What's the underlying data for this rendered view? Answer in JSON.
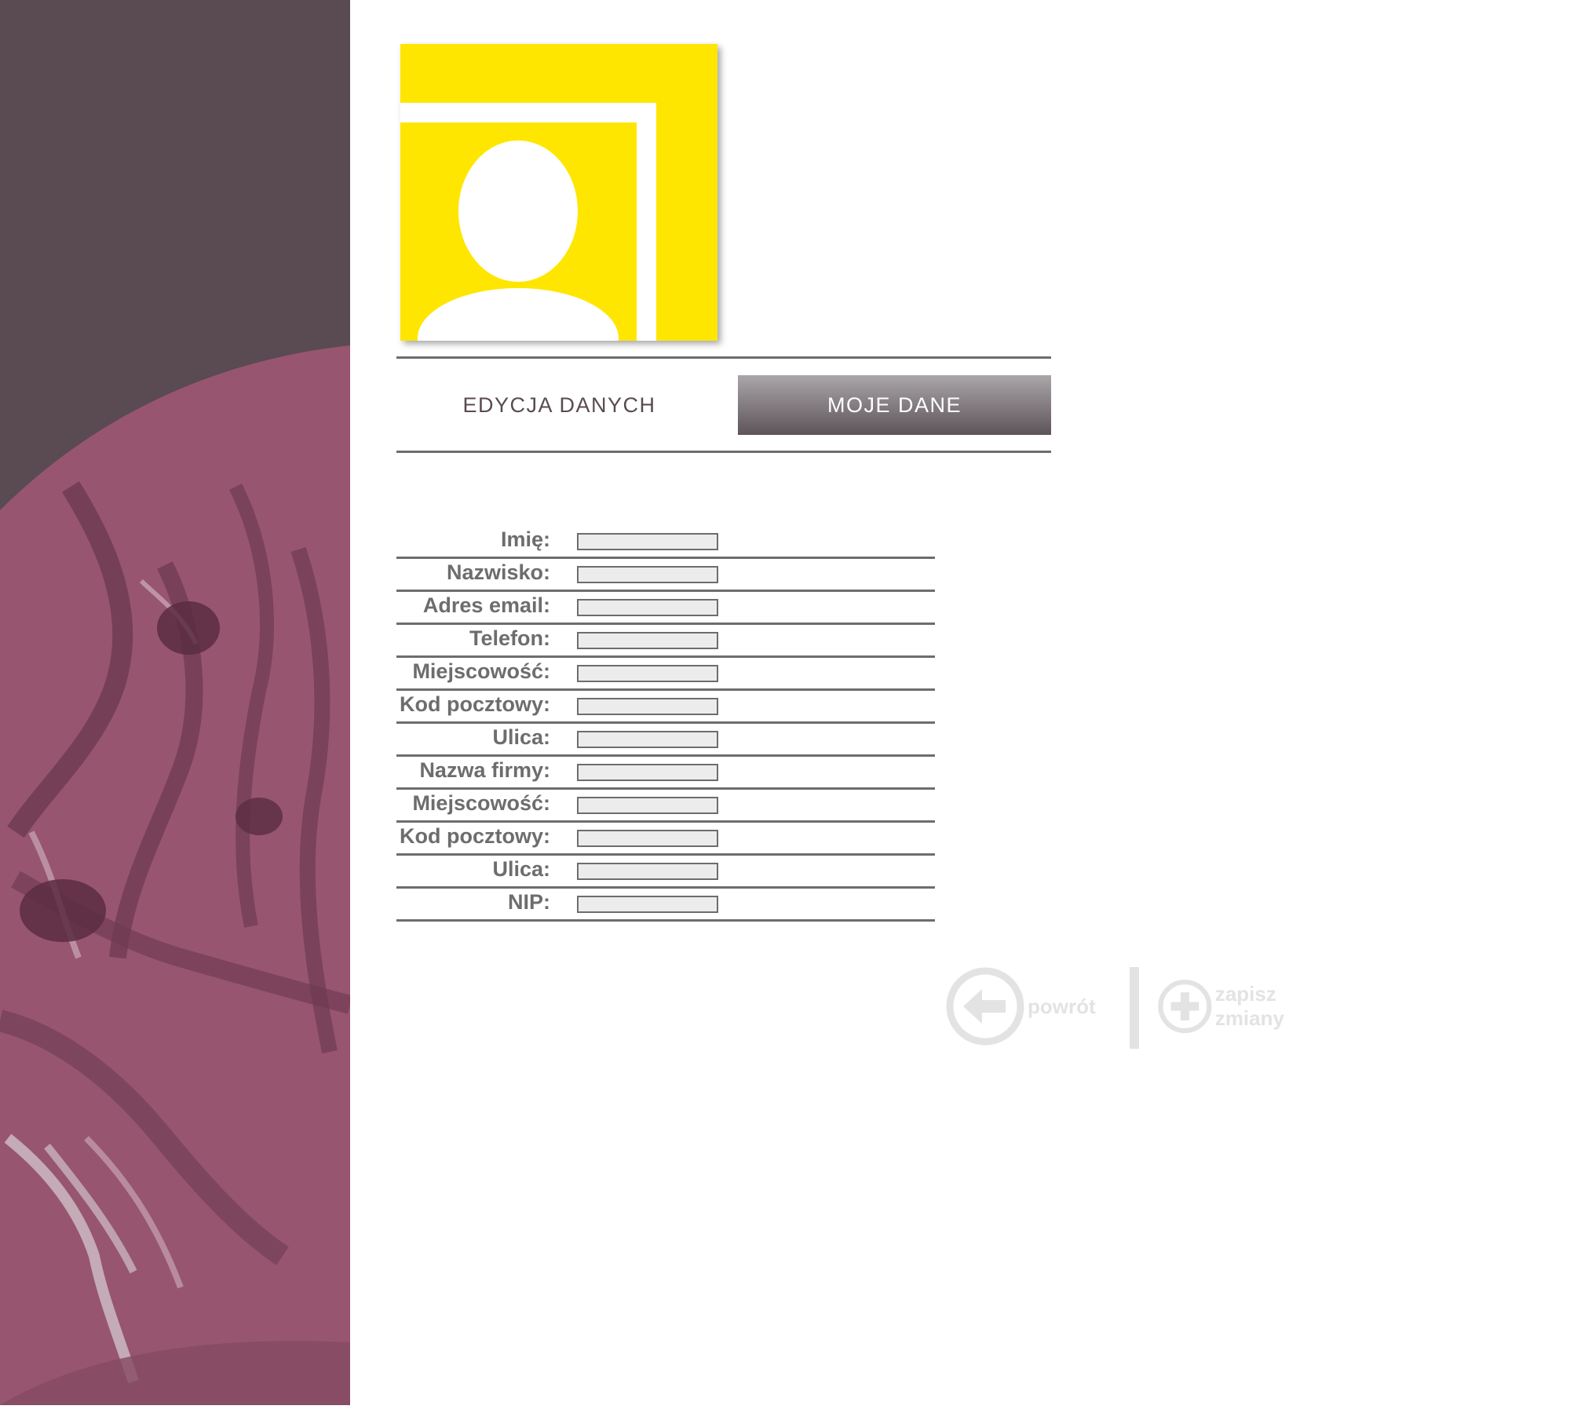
{
  "tabs": {
    "edit_label": "EDYCJA DANYCH",
    "mine_label": "MOJE DANE"
  },
  "form": {
    "fields": [
      {
        "label": "Imię:",
        "value": ""
      },
      {
        "label": "Nazwisko:",
        "value": ""
      },
      {
        "label": "Adres email:",
        "value": ""
      },
      {
        "label": "Telefon:",
        "value": ""
      },
      {
        "label": "Miejscowość:",
        "value": ""
      },
      {
        "label": "Kod pocztowy:",
        "value": ""
      },
      {
        "label": "Ulica:",
        "value": ""
      },
      {
        "label": "Nazwa firmy:",
        "value": ""
      },
      {
        "label": "Miejscowość:",
        "value": ""
      },
      {
        "label": "Kod pocztowy:",
        "value": ""
      },
      {
        "label": "Ulica:",
        "value": ""
      },
      {
        "label": "NIP:",
        "value": ""
      }
    ]
  },
  "actions": {
    "back_label": "powrót",
    "save_label": "zapisz zmiany"
  },
  "colors": {
    "side_dark": "#5a4a52",
    "side_pink": "#975570",
    "avatar_yellow": "#ffe600",
    "rule": "#6d6d6d",
    "action_gray": "#e3e3e3"
  },
  "icons": {
    "avatar": "user-silhouette-icon",
    "back": "arrow-left-circle-icon",
    "save": "plus-circle-icon"
  }
}
